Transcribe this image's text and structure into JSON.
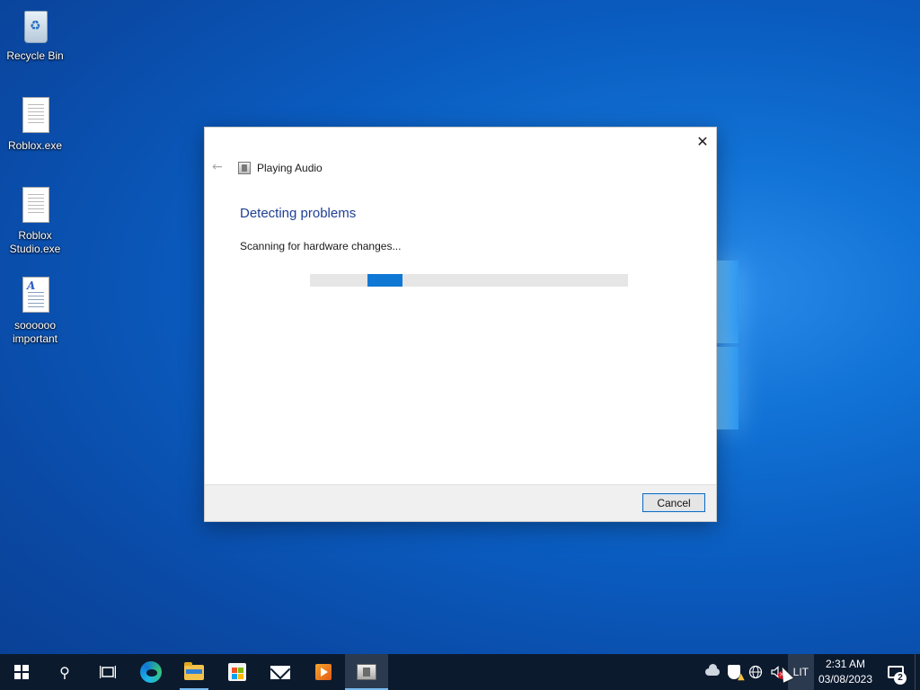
{
  "desktop": {
    "icons": [
      {
        "label": "Recycle Bin",
        "icon": "recycle-bin-icon"
      },
      {
        "label": "Roblox.exe",
        "icon": "file-icon"
      },
      {
        "label": "Roblox\nStudio.exe",
        "icon": "file-icon"
      },
      {
        "label": "soooooo\nimportant",
        "icon": "wordpad-document-icon"
      }
    ]
  },
  "dialog": {
    "nav_title": "Playing Audio",
    "heading": "Detecting problems",
    "status": "Scanning for hardware changes...",
    "progress": {
      "indeterminate": true,
      "chunk_start_fraction": 0.18,
      "chunk_width_fraction": 0.11
    },
    "cancel_label": "Cancel",
    "close_glyph": "✕",
    "back_glyph": "←",
    "accent_color": "#0f78d4",
    "heading_color": "#1e3f94"
  },
  "taskbar": {
    "pinned": [
      {
        "icon": "start-icon"
      },
      {
        "icon": "search-icon",
        "glyph": "⚲"
      },
      {
        "icon": "task-view-icon"
      },
      {
        "icon": "edge-icon"
      },
      {
        "icon": "file-explorer-icon"
      },
      {
        "icon": "microsoft-store-icon"
      },
      {
        "icon": "mail-icon"
      },
      {
        "icon": "media-player-icon"
      },
      {
        "icon": "troubleshooter-icon",
        "active": true
      }
    ],
    "tray": {
      "language": "LIT",
      "time": "2:31 AM",
      "date": "03/08/2023",
      "notification_count": "2"
    }
  }
}
